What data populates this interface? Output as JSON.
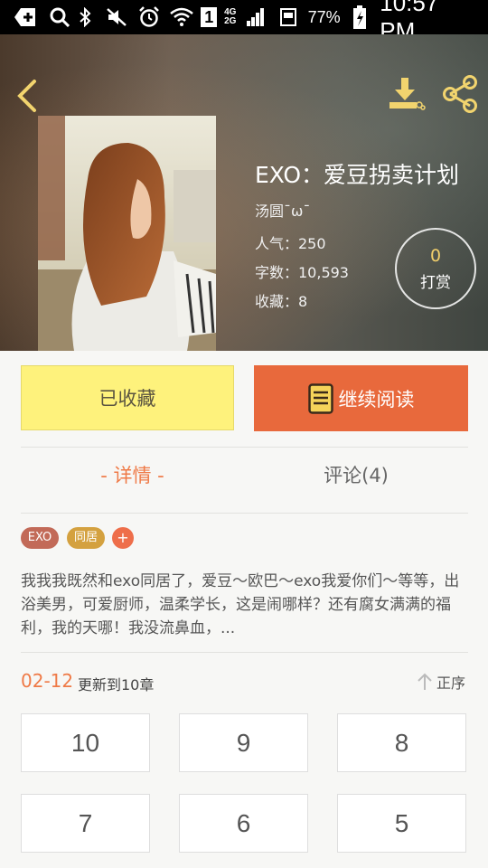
{
  "status_bar": {
    "battery": "77%",
    "time": "10:57 PM",
    "network_top": "4G",
    "network_bottom": "2G",
    "sim": "1"
  },
  "header": {
    "back_icon": "chevron-left-icon",
    "download_icon": "download-icon",
    "share_icon": "share-icon"
  },
  "book": {
    "title": "EXO：爱豆拐卖计划",
    "author": "汤圆¯ω¯",
    "popularity": "人气：250",
    "word_count": "字数：10,593",
    "favorites": "收藏：8",
    "tip_count": "0",
    "tip_label": "打赏"
  },
  "actions": {
    "favorited_label": "已收藏",
    "continue_label": "继续阅读"
  },
  "tabs": {
    "detail": "- 详情 -",
    "comments": "评论(4)"
  },
  "tags": {
    "items": [
      "EXO",
      "同居"
    ],
    "add": "+"
  },
  "summary": "我我我既然和exo同居了，爱豆～欧巴～exo我爱你们～等等，出浴美男，可爱厨师，温柔学长，这是闹哪样？还有腐女满满的福利，我的天哪！我没流鼻血，...",
  "updates": {
    "date": "02-12",
    "text": "更新到10章",
    "order_label": "正序"
  },
  "chapters": [
    "10",
    "9",
    "8",
    "7",
    "6",
    "5"
  ],
  "colors": {
    "accent": "#e8693c",
    "fav_button": "#fef27c",
    "tip_count": "#f2cf6b"
  }
}
